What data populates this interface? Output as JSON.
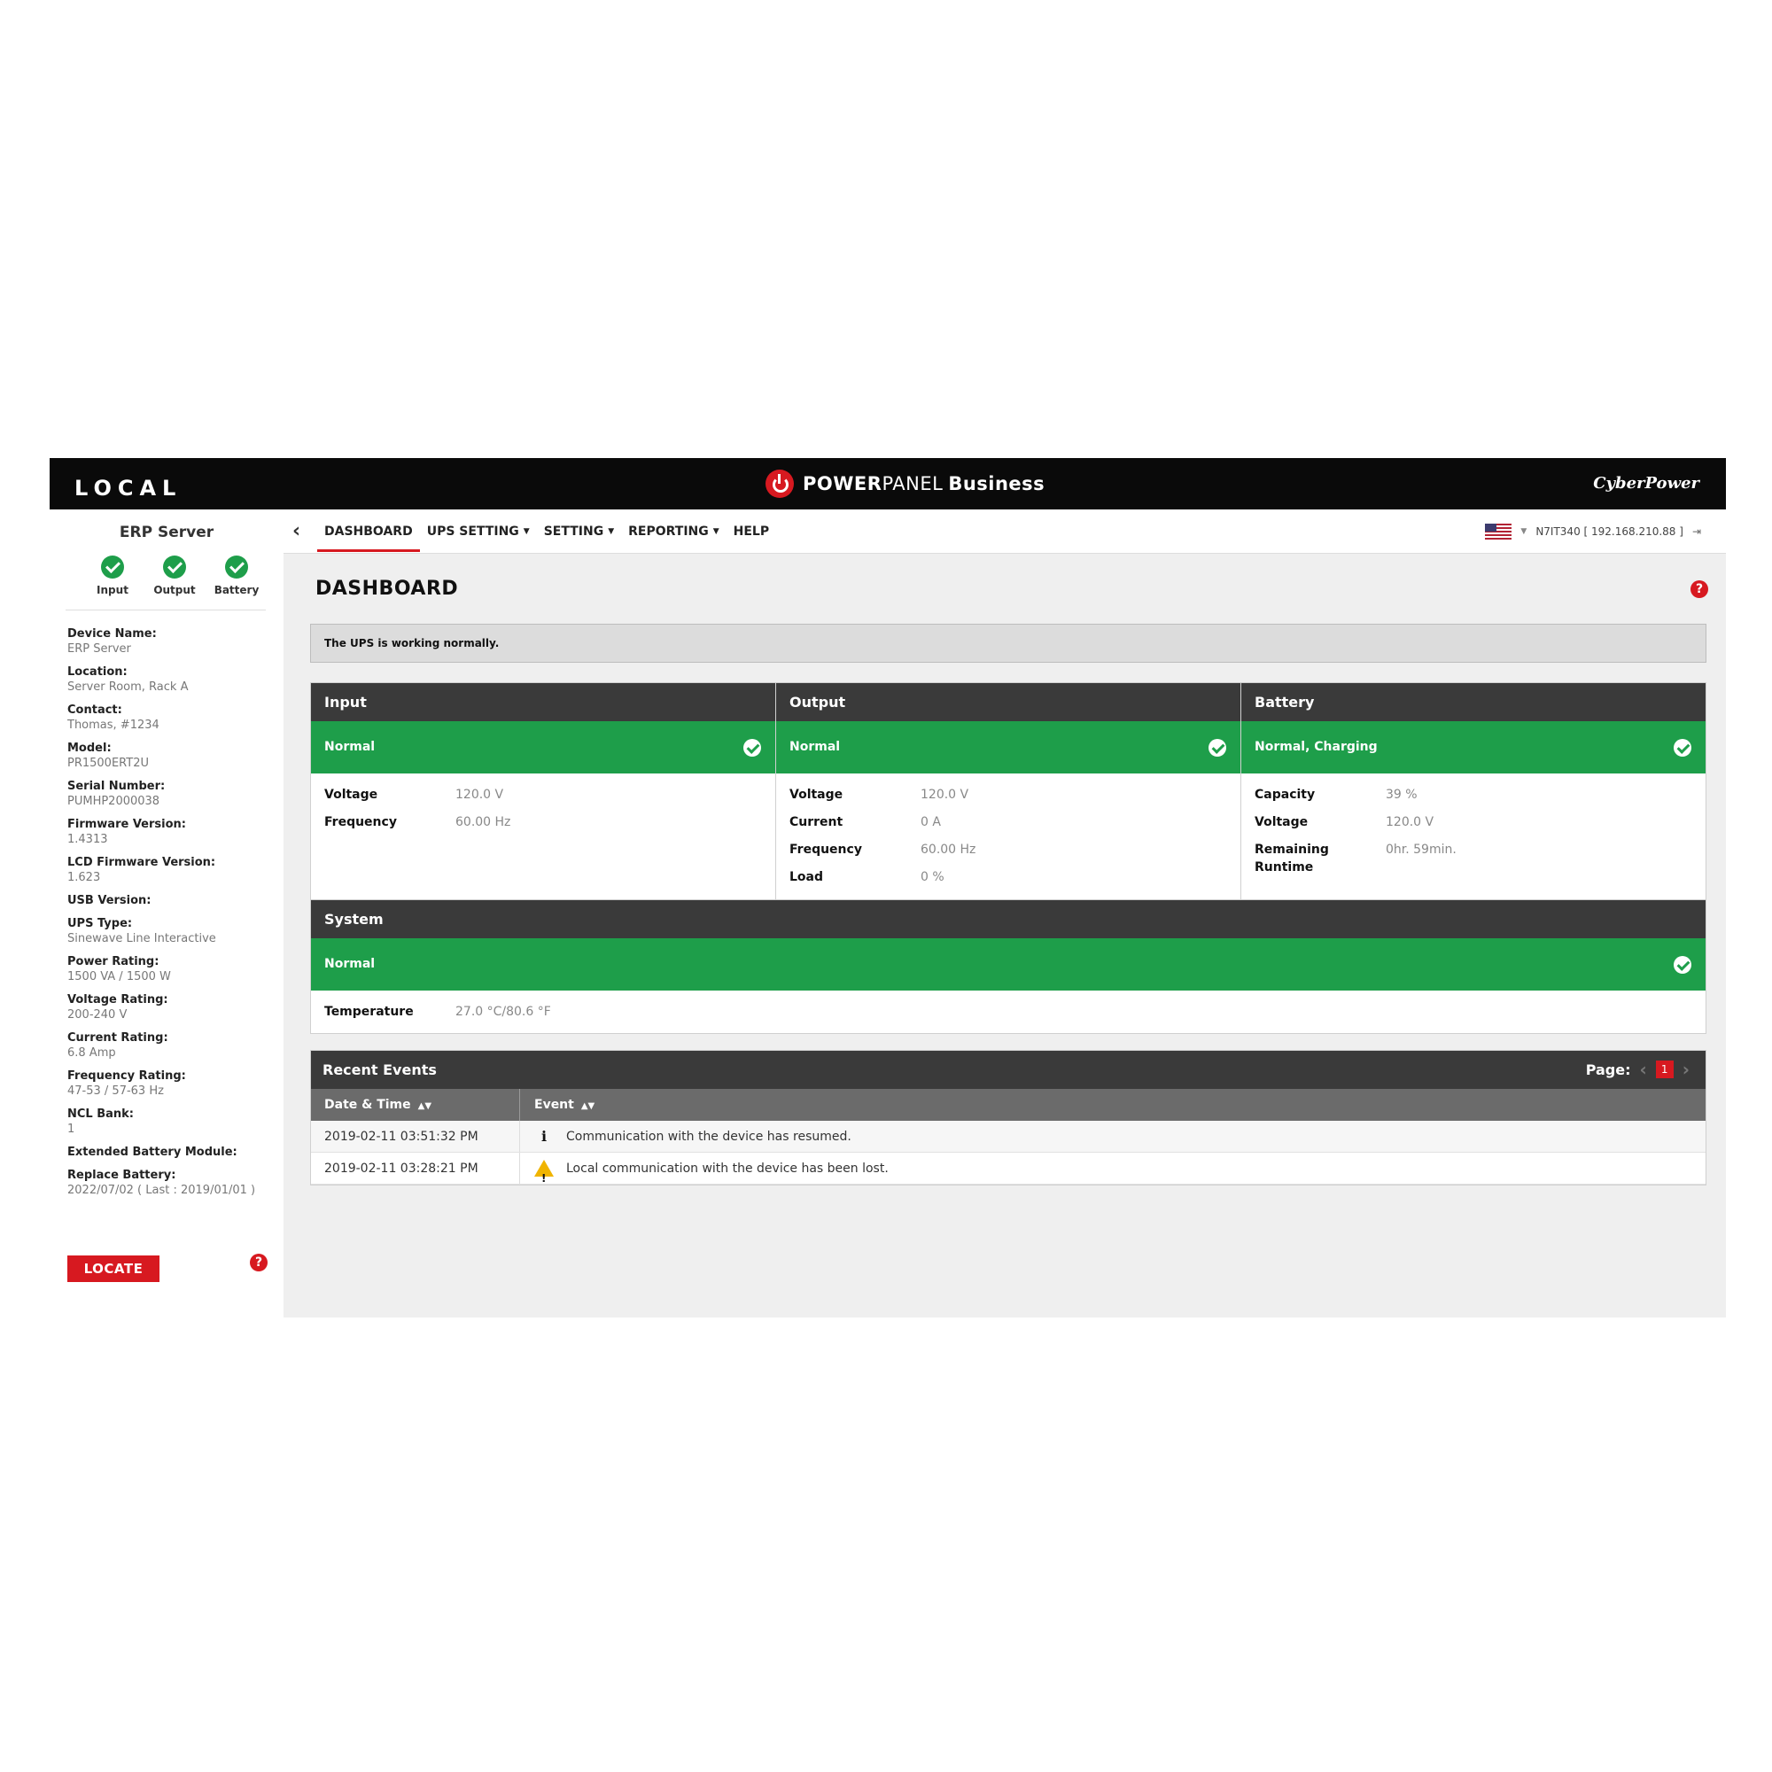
{
  "topbar": {
    "mode": "LOCAL",
    "brand_bold": "POWER",
    "brand_regular": "PANEL",
    "brand_edition": "Business",
    "vendor": "CyberPower"
  },
  "sidebar": {
    "device_title": "ERP Server",
    "status": [
      {
        "label": "Input",
        "state": "ok"
      },
      {
        "label": "Output",
        "state": "ok"
      },
      {
        "label": "Battery",
        "state": "ok"
      }
    ],
    "info": [
      {
        "label": "Device Name:",
        "value": "ERP Server"
      },
      {
        "label": "Location:",
        "value": "Server Room, Rack A"
      },
      {
        "label": "Contact:",
        "value": "Thomas, #1234"
      },
      {
        "label": "Model:",
        "value": "PR1500ERT2U"
      },
      {
        "label": "Serial Number:",
        "value": "PUMHP2000038"
      },
      {
        "label": "Firmware Version:",
        "value": "1.4313"
      },
      {
        "label": "LCD Firmware Version:",
        "value": "1.623"
      },
      {
        "label": "USB Version:",
        "value": ""
      },
      {
        "label": "UPS Type:",
        "value": "Sinewave Line Interactive"
      },
      {
        "label": "Power Rating:",
        "value": "1500 VA / 1500 W"
      },
      {
        "label": "Voltage Rating:",
        "value": "200-240 V"
      },
      {
        "label": "Current Rating:",
        "value": "6.8 Amp"
      },
      {
        "label": "Frequency Rating:",
        "value": "47-53 / 57-63 Hz"
      },
      {
        "label": "NCL Bank:",
        "value": "1"
      },
      {
        "label": "Extended Battery Module:",
        "value": ""
      },
      {
        "label": "Replace Battery:",
        "value": "2022/07/02 ( Last : 2019/01/01 )"
      }
    ],
    "locate_label": "LOCATE",
    "help_glyph": "?"
  },
  "nav": {
    "back_glyph": "‹",
    "items": [
      {
        "label": "DASHBOARD",
        "active": true,
        "dropdown": false
      },
      {
        "label": "UPS SETTING",
        "active": false,
        "dropdown": true
      },
      {
        "label": "SETTING",
        "active": false,
        "dropdown": true
      },
      {
        "label": "REPORTING",
        "active": false,
        "dropdown": true
      },
      {
        "label": "HELP",
        "active": false,
        "dropdown": false
      }
    ],
    "host": "N7IT340 [ 192.168.210.88 ]",
    "language": "en-US"
  },
  "main": {
    "title": "DASHBOARD",
    "help_glyph": "?",
    "notice": "The UPS is working normally.",
    "panels": {
      "input": {
        "title": "Input",
        "status": "Normal",
        "rows": [
          {
            "k": "Voltage",
            "v": "120.0 V"
          },
          {
            "k": "Frequency",
            "v": "60.00 Hz"
          }
        ]
      },
      "output": {
        "title": "Output",
        "status": "Normal",
        "rows": [
          {
            "k": "Voltage",
            "v": "120.0 V"
          },
          {
            "k": "Current",
            "v": "0 A"
          },
          {
            "k": "Frequency",
            "v": "60.00 Hz"
          },
          {
            "k": "Load",
            "v": "0 %"
          }
        ]
      },
      "battery": {
        "title": "Battery",
        "status": "Normal, Charging",
        "rows": [
          {
            "k": "Capacity",
            "v": "39 %"
          },
          {
            "k": "Voltage",
            "v": "120.0 V"
          },
          {
            "k": "Remaining Runtime",
            "v": "0hr. 59min."
          }
        ]
      },
      "system": {
        "title": "System",
        "status": "Normal",
        "rows": [
          {
            "k": "Temperature",
            "v": "27.0 °C/80.6 °F"
          }
        ]
      }
    },
    "events": {
      "title": "Recent Events",
      "page_label": "Page:",
      "current_page": "1",
      "columns": [
        "Date & Time",
        "Event"
      ],
      "rows": [
        {
          "datetime": "2019-02-11 03:51:32 PM",
          "icon": "info-icon",
          "event": "Communication with the device has resumed."
        },
        {
          "datetime": "2019-02-11 03:28:21 PM",
          "icon": "warning-icon",
          "event": "Local communication with the device has been lost."
        }
      ]
    }
  },
  "colors": {
    "brand_red": "#d71920",
    "status_green": "#1e9e4a",
    "header_dark": "#3a3a3a",
    "topbar_black": "#0a0a0a"
  }
}
